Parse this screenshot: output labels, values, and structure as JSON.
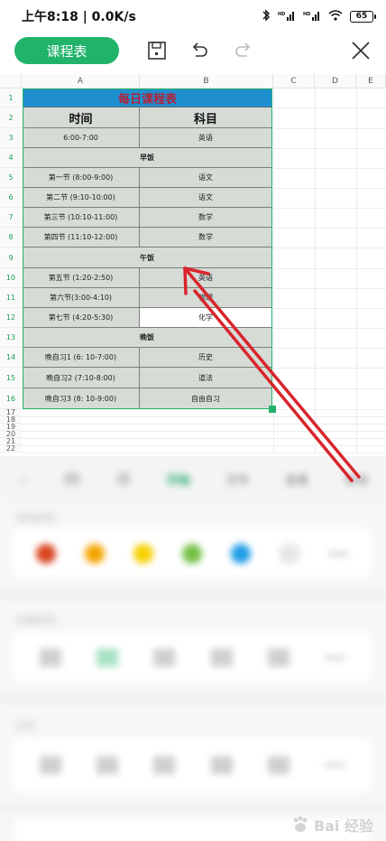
{
  "status": {
    "time_speed": "上午8:18 | 0.0K/s",
    "signal1": "HD",
    "signal2": "HD",
    "battery": "65"
  },
  "toolbar": {
    "course_button": "课程表"
  },
  "columns": [
    "A",
    "B",
    "C",
    "D",
    "E"
  ],
  "rows": [
    "1",
    "2",
    "3",
    "4",
    "5",
    "6",
    "7",
    "8",
    "9",
    "10",
    "11",
    "12",
    "13",
    "14",
    "15",
    "16"
  ],
  "extra_rows": [
    "17",
    "18",
    "19",
    "20",
    "21",
    "22"
  ],
  "table": {
    "title": "每日课程表",
    "header_time": "时间",
    "header_subject": "科目",
    "r3": {
      "time": "6:00-7:00",
      "subject": "英语"
    },
    "r4": "早饭",
    "r5": {
      "time": "第一节 (8:00-9:00)",
      "subject": "语文"
    },
    "r6": {
      "time": "第二节 (9:10-10:00)",
      "subject": "语文"
    },
    "r7": {
      "time": "第三节 (10:10-11:00)",
      "subject": "数学"
    },
    "r8": {
      "time": "第四节 (11:10-12:00)",
      "subject": "数学"
    },
    "r9": "午饭",
    "r10": {
      "time": "第五节 (1:20-2:50)",
      "subject": "英语"
    },
    "r11": {
      "time": "第六节(3:00-4:10)",
      "subject": "物理"
    },
    "r12": {
      "time": "第七节 (4:20-5:30)",
      "subject": "化学"
    },
    "r13": "晚饭",
    "r14": {
      "time": "晚自习1 (6: 10-7:00)",
      "subject": "历史"
    },
    "r15": {
      "time": "晚自习2 (7:10-8:00)",
      "subject": "道法"
    },
    "r16": {
      "time": "晚自习3 (8: 10-9:00)",
      "subject": "自由自习"
    }
  },
  "panel": {
    "tabs": [
      "开始",
      "文件",
      "查看",
      "审阅"
    ],
    "active_tab": "开始",
    "section1": "填充颜色",
    "section2": "边框类型",
    "section3": "对齐"
  },
  "watermark": "Bai 经验",
  "colors": {
    "accent": "#21b36a",
    "title_fill": "#1f8fcf",
    "title_text": "#b22238",
    "cell_fill": "#d6dbd6",
    "arrow": "#d9252c"
  }
}
